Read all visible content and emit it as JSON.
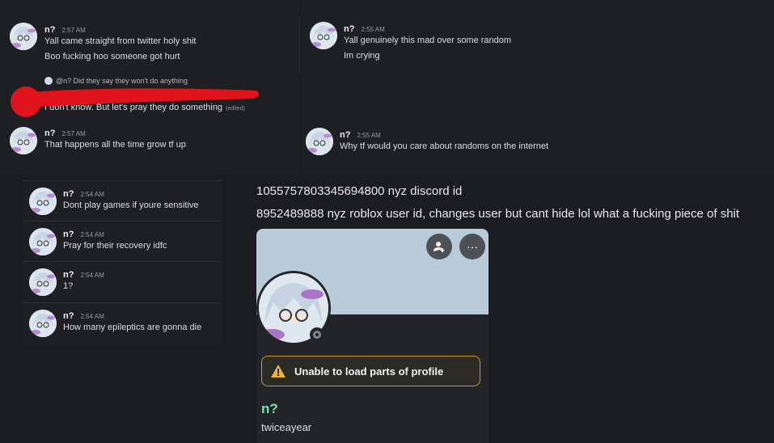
{
  "messages_top_left": [
    {
      "author": "n?",
      "time": "2:57 AM",
      "lines": [
        "Yall came straight from twitter holy shit",
        "Boo fucking hoo someone got hurt"
      ]
    }
  ],
  "reply": {
    "reply_to": "@n? Did they say they won't do anything",
    "text": "I don't know. But let's pray they do something",
    "edited": "(edited)"
  },
  "message_mid_left": {
    "author": "n?",
    "time": "2:57 AM",
    "text": "That happens all the time grow tf up"
  },
  "message_top_right": {
    "author": "n?",
    "time": "2:55 AM",
    "lines": [
      "Yall genuinely this mad over some random",
      "Im crying"
    ]
  },
  "message_mid_right": {
    "author": "n?",
    "time": "2:55 AM",
    "text": "Why tf would you care about randoms on the internet"
  },
  "lower_messages": [
    {
      "author": "n?",
      "time": "2:54 AM",
      "text": "Dont play games if youre sensitive"
    },
    {
      "author": "n?",
      "time": "2:54 AM",
      "text": "Pray for their recovery idfc"
    },
    {
      "author": "n?",
      "time": "2:54 AM",
      "text": "1?"
    },
    {
      "author": "n?",
      "time": "2:54 AM",
      "text": "How many epileptics are gonna die"
    }
  ],
  "annotation": {
    "line1": "1055757803345694800  nyz discord id",
    "line2": "8952489888 nyz roblox user id, changes user but cant hide lol what a fucking piece of shit"
  },
  "profile": {
    "warning": "Unable to load parts of profile",
    "display_name": "n?",
    "username": "twiceayear",
    "menu_glyph": "···"
  },
  "colors": {
    "background": "#1b1c1f",
    "warning_border": "#c99a2e",
    "name_green": "#7ee0b0",
    "scribble_red": "#e0131c"
  },
  "icons": [
    "anime-avatar-icon",
    "add-friend-icon",
    "more-options-icon",
    "warning-icon",
    "status-offline-icon"
  ]
}
